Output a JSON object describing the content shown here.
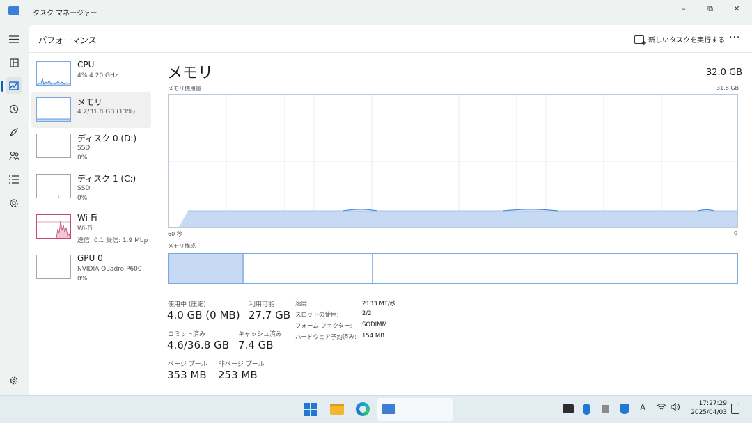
{
  "window": {
    "title": "タスク マネージャー",
    "minimize": "–",
    "maximize": "⧉",
    "close": "✕"
  },
  "rail": {
    "items": [
      {
        "icon": "hamburger-menu-icon",
        "glyph": "≡"
      },
      {
        "icon": "processes-icon",
        "glyph": "▦"
      },
      {
        "icon": "performance-icon",
        "glyph": "⬚"
      },
      {
        "icon": "app-history-icon",
        "glyph": "↺"
      },
      {
        "icon": "startup-apps-icon",
        "glyph": "➚"
      },
      {
        "icon": "users-icon",
        "glyph": "👥"
      },
      {
        "icon": "details-icon",
        "glyph": "☰"
      },
      {
        "icon": "services-icon",
        "glyph": "⚙"
      },
      {
        "icon": "settings-icon",
        "glyph": "⚙"
      }
    ]
  },
  "header": {
    "title": "パフォーマンス",
    "run_task": "新しいタスクを実行する",
    "more": "···"
  },
  "devices": [
    {
      "name": "CPU",
      "sub1": "4%  4.20 GHz",
      "sub2": "",
      "sub3": ""
    },
    {
      "name": "メモリ",
      "sub1": "4.2/31.8 GB (13%)",
      "sub2": "",
      "sub3": ""
    },
    {
      "name": "ディスク 0 (D:)",
      "sub1": "SSD",
      "sub2": "0%",
      "sub3": ""
    },
    {
      "name": "ディスク 1 (C:)",
      "sub1": "SSD",
      "sub2": "0%",
      "sub3": ""
    },
    {
      "name": "Wi-Fi",
      "sub1": "Wi-Fi",
      "sub2": "送信: 0.1  受信: 1.9 Mbp",
      "sub3": ""
    },
    {
      "name": "GPU 0",
      "sub1": "NVIDIA Quadro P600",
      "sub2": "0%",
      "sub3": ""
    }
  ],
  "memory": {
    "title": "メモリ",
    "total": "32.0 GB",
    "usage_label": "メモリ使用量",
    "usage_max": "31.8 GB",
    "graph_left": "60 秒",
    "graph_right": "0",
    "composition_label": "メモリ構成",
    "composition": {
      "in_use_fraction": 0.13,
      "modified_fraction": 0.004,
      "standby_end_fraction": 0.357
    },
    "stats": {
      "in_use_label": "使用中 (圧縮)",
      "in_use_value": "4.0 GB (0 MB)",
      "available_label": "利用可能",
      "available_value": "27.7 GB",
      "committed_label": "コミット済み",
      "committed_value": "4.6/36.8 GB",
      "cached_label": "キャッシュ済み",
      "cached_value": "7.4 GB",
      "paged_label": "ページ プール",
      "paged_value": "353 MB",
      "nonpaged_label": "非ページ プール",
      "nonpaged_value": "253 MB"
    },
    "specs": [
      {
        "label": "速度:",
        "value": "2133 MT/秒"
      },
      {
        "label": "スロットの使用:",
        "value": "2/2"
      },
      {
        "label": "フォーム ファクター:",
        "value": "SODIMM"
      },
      {
        "label": "ハードウェア予約済み:",
        "value": "154 MB"
      }
    ]
  },
  "taskbar": {
    "clock_time": "17:27:29",
    "clock_date": "2025/04/03",
    "tray": [
      "nvidia-icon",
      "bluetooth-icon",
      "stop-icon",
      "security-icon",
      "ime-icon",
      "wifi-icon",
      "volume-icon"
    ],
    "ime_glyph": "A"
  },
  "colors": {
    "accent": "#0a5fc2",
    "memory_fill": "#c7daf3",
    "memory_border": "#7aa8dc",
    "wifi_line": "#c24b7a"
  }
}
